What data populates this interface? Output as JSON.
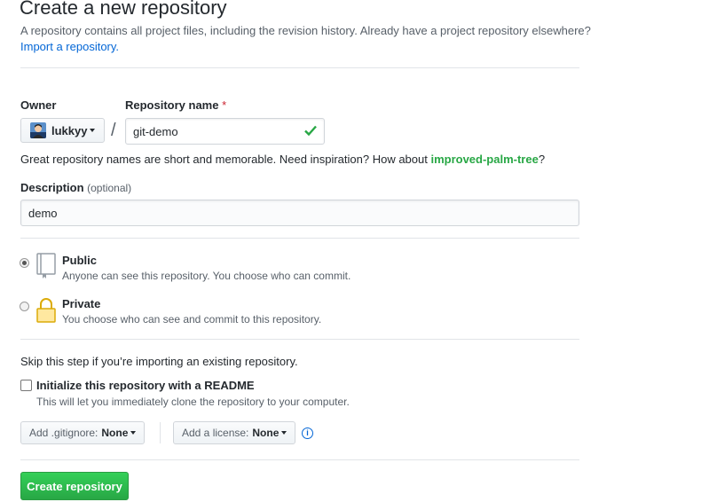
{
  "header": {
    "title": "Create a new repository",
    "subtitle": "A repository contains all project files, including the revision history. Already have a project repository elsewhere?",
    "import_link": "Import a repository."
  },
  "owner": {
    "label": "Owner",
    "name": "lukkyy",
    "avatar_icon": "user-avatar-icon"
  },
  "slash": "/",
  "repo": {
    "label": "Repository name",
    "required_mark": "*",
    "value": "git-demo",
    "valid_icon": "checkmark-icon"
  },
  "hint": {
    "text_before": "Great repository names are short and memorable. Need inspiration? How about ",
    "suggestion": "improved-palm-tree",
    "text_after": "?"
  },
  "description": {
    "label": "Description",
    "optional": "(optional)",
    "value": "demo"
  },
  "visibility": {
    "selected": "Public",
    "public": {
      "title": "Public",
      "note": "Anyone can see this repository. You choose who can commit.",
      "icon": "repo-book-icon"
    },
    "private": {
      "title": "Private",
      "note": "You choose who can see and commit to this repository.",
      "icon": "lock-icon"
    }
  },
  "init": {
    "skip_text": "Skip this step if you’re importing an existing repository.",
    "readme_label": "Initialize this repository with a README",
    "readme_checked": false,
    "readme_note": "This will let you immediately clone the repository to your computer."
  },
  "gitignore": {
    "label": "Add .gitignore:",
    "value": "None"
  },
  "license": {
    "label": "Add a license:",
    "value": "None"
  },
  "info_icon": "info-icon",
  "create_button": "Create repository",
  "colors": {
    "primary_button": "#28a745",
    "link": "#0366d6",
    "suggestion": "#28a745",
    "required": "#cb2431"
  }
}
